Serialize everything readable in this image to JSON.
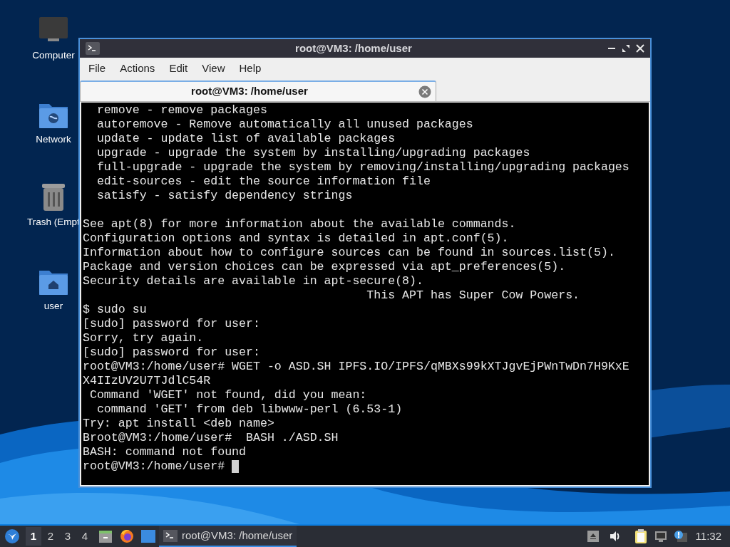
{
  "desktop_icons": [
    {
      "kind": "computer",
      "label": "Computer"
    },
    {
      "kind": "network",
      "label": "Network"
    },
    {
      "kind": "trash",
      "label": "Trash (Empt"
    },
    {
      "kind": "home",
      "label": "user"
    }
  ],
  "window": {
    "title": "root@VM3: /home/user",
    "menu": [
      "File",
      "Actions",
      "Edit",
      "View",
      "Help"
    ],
    "tabs": [
      {
        "label": "root@VM3: /home/user",
        "selected": true
      }
    ],
    "terminal": {
      "blocks": [
        [
          "  remove - remove packages",
          "  autoremove - Remove automatically all unused packages",
          "  update - update list of available packages",
          "  upgrade - upgrade the system by installing/upgrading packages",
          "  full-upgrade - upgrade the system by removing/installing/upgrading packages",
          "  edit-sources - edit the source information file",
          "  satisfy - satisfy dependency strings"
        ],
        [
          "See apt(8) for more information about the available commands.",
          "Configuration options and syntax is detailed in apt.conf(5).",
          "Information about how to configure sources can be found in sources.list(5).",
          "Package and version choices can be expressed via apt_preferences(5).",
          "Security details are available in apt-secure(8).",
          "                                        This APT has Super Cow Powers.",
          "$ sudo su",
          "[sudo] password for user:",
          "Sorry, try again.",
          "[sudo] password for user:",
          "root@VM3:/home/user# WGET -o ASD.SH IPFS.IO/IPFS/qMBXs99kXTJgvEjPWnTwDn7H9KxE",
          "X4IIzUV2U7TJdlC54R",
          " Command 'WGET' not found, did you mean:",
          "  command 'GET' from deb libwww-perl (6.53-1)",
          "Try: apt install <deb name>",
          "Broot@VM3:/home/user#  BASH ./ASD.SH",
          "BASH: command not found",
          "root@VM3:/home/user# "
        ]
      ]
    }
  },
  "taskbar": {
    "workspaces": [
      {
        "label": "1",
        "selected": true
      },
      {
        "label": "2",
        "selected": false
      },
      {
        "label": "3",
        "selected": false
      },
      {
        "label": "4",
        "selected": false
      }
    ],
    "tasks": [
      {
        "label": "root@VM3: /home/user",
        "selected": true
      }
    ],
    "clock": "11:32"
  }
}
